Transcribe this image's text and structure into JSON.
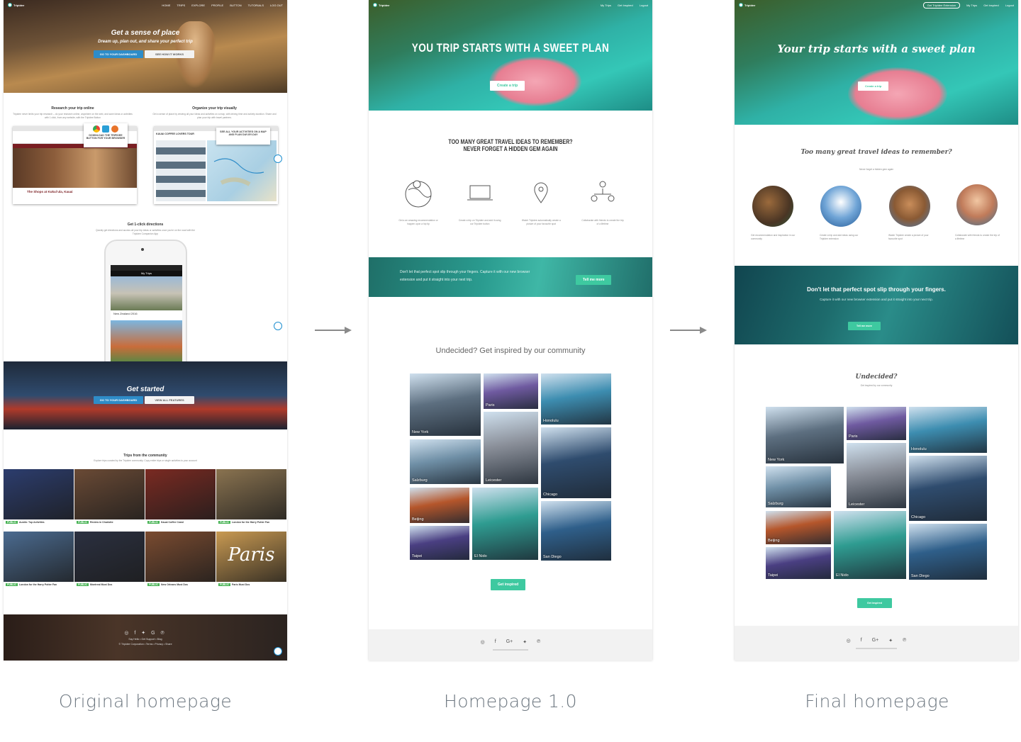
{
  "captions": {
    "original": "Original homepage",
    "v1": "Homepage 1.0",
    "final": "Final homepage"
  },
  "original": {
    "logo": "Tripidee",
    "nav": [
      "HOME",
      "TRIPS",
      "EXPLORE",
      "PROFILE",
      "BUTTON",
      "TUTORIALS",
      "LOG OUT"
    ],
    "hero_title": "Get a sense of place",
    "hero_sub": "Dream up, plan out, and share your perfect trip",
    "hero_btn_primary": "GO TO YOUR DASHBOARD",
    "hero_btn_secondary": "SEE HOW IT WORKS",
    "features": [
      {
        "title": "Research your trip online",
        "text": "Tripidee never limits your trip research – do your research online, anywhere on the web, and save ideas or activities with 1 click, from any website, with the Tripidee Button",
        "overlay": "DOWNLOAD THE TRIPIDEE BUTTON FOR YOUR BROWSER",
        "card_title": "The Shops at Kukuiʻula, Kauai"
      },
      {
        "title": "Organize your trip visually",
        "text": "Get a sense of place by viewing all your ideas and activities on a map, with driving time and activity duration. Share and plan your trip with travel partners.",
        "overlay": "SEE ALL YOUR ACTIVITIES ON A MAP AND PLAN DAY-BY-DAY",
        "card_title": "KAUAI COFFEE LOVERS TOUR"
      }
    ],
    "directions": {
      "title": "Get 1-click directions",
      "text": "Quickly get directions and access all your trip ideas or activities once you're on the road with the Tripidee Companion App",
      "phone_header": "My Trips",
      "phone_card": "New Zealand 2016"
    },
    "get_started": {
      "title": "Get started",
      "btn_primary": "GO TO YOUR DASHBOARD",
      "btn_secondary": "VIEW ALL FEATURES"
    },
    "community": {
      "title": "Trips from the community",
      "text": "Explore trips curated by the Tripidee community. Copy entire trips or single activities to your account",
      "trips": [
        {
          "name": "Austin: Top Activities",
          "badge": "PUBLIC",
          "color": "#2c3d6e"
        },
        {
          "name": "Review in Charlotte",
          "badge": "PUBLIC",
          "color": "#6a4a35"
        },
        {
          "name": "Kauai Coffee Crawl",
          "badge": "PUBLIC",
          "color": "#7a2a22"
        },
        {
          "name": "London for the Harry Potter Fan",
          "badge": "PUBLIC",
          "color": "#8a7350"
        },
        {
          "name": "London for the Harry Potter Fan",
          "badge": "PUBLIC",
          "color": "#4b6b90"
        },
        {
          "name": "Montreal Must Dos",
          "badge": "PUBLIC",
          "color": "#2b3040"
        },
        {
          "name": "New Orleans Must Dos",
          "badge": "PUBLIC",
          "color": "#7a4b30"
        },
        {
          "name": "Paris Must Dos",
          "badge": "PUBLIC",
          "color": "#c99a52"
        }
      ],
      "paris_script": "Paris"
    },
    "footer": {
      "links": "Say Hello • Get Support • Blog",
      "legal": "© Tripidee Corporation • Terms • Privacy • Share"
    },
    "colors": {
      "brand_blue": "#2e8cc8",
      "chip_blue": "#1e8fd0"
    }
  },
  "v1": {
    "logo": "Tripidee",
    "nav": [
      "My Trips",
      "Get Inspired",
      "Logout"
    ],
    "hero_title": "YOU TRIP STARTS WITH A SWEET PLAN",
    "hero_btn": "Create a trip",
    "section_title_1": "TOO MANY GREAT TRAVEL IDEAS TO REMEMBER?",
    "section_title_2": "NEVER FORGET A HIDDEN GEM AGAIN",
    "features": [
      {
        "icon": "globe-map-icon",
        "text": "Get a an amazing recommendation or happen upon a hip tip"
      },
      {
        "icon": "laptop-icon",
        "text": "Create a trip on Tripidee and add it using our Tripidee button"
      },
      {
        "icon": "map-pin-icon",
        "text": "Watch Tripidee automatically create a picture of your favourite spot"
      },
      {
        "icon": "people-network-icon",
        "text": "Collaborate with friends to create the trip of a lifetime"
      }
    ],
    "band_text": "Don't let that perfect spot slip through your fingers. Capture it with our new browser extension and put it straight into your next trip.",
    "band_btn": "Tell me more",
    "community_title": "Undecided? Get inspired by our community",
    "cities": [
      "New York",
      "Paris",
      "Honolulu",
      "Salzburg",
      "Leicester",
      "Chicago",
      "Beijing",
      "El Nido",
      "San Diego",
      "Taipei"
    ],
    "cta": "Get inspired",
    "footer_icons": [
      "instagram-icon",
      "facebook-icon",
      "google-plus-icon",
      "twitter-icon",
      "pinterest-icon"
    ],
    "footer_glyphs": [
      "◎",
      "f",
      "G+",
      "✦",
      "℗"
    ]
  },
  "final": {
    "logo": "Tripidee",
    "nav_btn": "Get Tripidee Extension",
    "nav": [
      "My Trips",
      "Get inspired",
      "Logout"
    ],
    "hero_title": "Your trip starts with a sweet plan",
    "hero_btn": "Create a trip",
    "section_title": "Too many great travel ideas to remember?",
    "section_sub": "Never forget a hidden gem again",
    "features": [
      {
        "text": "Get recommendation and inspiration in our community"
      },
      {
        "text": "Create a trip and add ideas using our Tripidee extension"
      },
      {
        "text": "Watch Tripidee create a picture of your favourite spot"
      },
      {
        "text": "Collaborate with friends to create the trip of a lifetime"
      }
    ],
    "band_title": "Don't let that perfect spot slip through your fingers.",
    "band_text": "Capture it with our new browser extension and put it straight into your next trip.",
    "band_btn": "Tell me more",
    "community_title": "Undecided?",
    "community_sub": "Get inspired by our community",
    "cities": [
      "New York",
      "Paris",
      "Honolulu",
      "Salzburg",
      "Leicester",
      "Chicago",
      "Beijing",
      "El Nido",
      "San Diego",
      "Taipei"
    ],
    "cta": "Get inspired",
    "footer_glyphs": [
      "◎",
      "f",
      "G+",
      "✦",
      "℗"
    ],
    "colors": {
      "accent_green": "#3ec9a0",
      "script_gray": "#555555"
    }
  },
  "city_colors": {
    "New York": "#5d6f80",
    "Paris": "#6f5aa0",
    "Honolulu": "#3d8db0",
    "Salzburg": "#6f8fa6",
    "Leicester": "#8a8f99",
    "Chicago": "#2f4c6e",
    "Beijing": "#b5562b",
    "El Nido": "#2f9c91",
    "San Diego": "#2f5f8a",
    "Taipei": "#4a3f82"
  }
}
